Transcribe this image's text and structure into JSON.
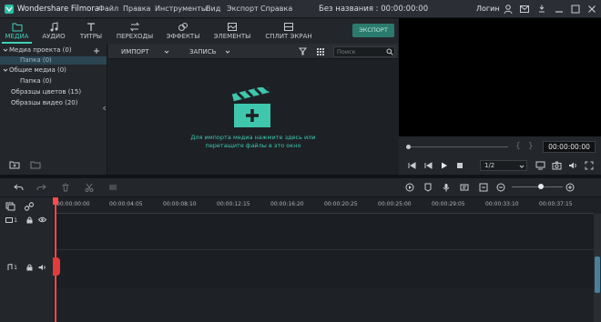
{
  "app": {
    "name": "Wondershare Filmora",
    "document_title": "Без названия : 00:00:00:00",
    "login": "Логин"
  },
  "menu": [
    "Файл",
    "Правка",
    "Инструменты",
    "Вид",
    "Экспорт",
    "Справка"
  ],
  "tabs": [
    {
      "label": "МЕДИА",
      "icon": "folder-icon",
      "active": true
    },
    {
      "label": "АУДИО",
      "icon": "music-note-icon",
      "active": false
    },
    {
      "label": "ТИТРЫ",
      "icon": "text-icon",
      "active": false
    },
    {
      "label": "ПЕРЕХОДЫ",
      "icon": "transition-icon",
      "active": false
    },
    {
      "label": "ЭФФЕКТЫ",
      "icon": "effects-icon",
      "active": false
    },
    {
      "label": "ЭЛЕМЕНТЫ",
      "icon": "elements-icon",
      "active": false
    },
    {
      "label": "СПЛИТ ЭКРАН",
      "icon": "split-screen-icon",
      "active": false
    }
  ],
  "export_label": "ЭКСПОРТ",
  "library": {
    "items": [
      {
        "label": "Медиа проекта (0)",
        "sub": false
      },
      {
        "label": "Папка (0)",
        "sub": true,
        "selected": true
      },
      {
        "label": "Общие медиа (0)",
        "sub": false
      },
      {
        "label": "Папка (0)",
        "sub": true
      },
      {
        "label": "Образцы цветов (15)",
        "sub": false
      },
      {
        "label": "Образцы видео (20)",
        "sub": false
      }
    ]
  },
  "media_toolbar": {
    "import_label": "ИМПОРТ",
    "record_label": "ЗАПИСЬ",
    "search_placeholder": "Поиск"
  },
  "media_hint": "Для импорта медиа нажмите здесь или перетащите файлы в это окно",
  "preview": {
    "timecode": "00:00:00:00",
    "ratio": "1/2"
  },
  "ruler": [
    "00:00:00:00",
    "00:00:04:05",
    "00:00:08:10",
    "00:00:12:15",
    "00:00:16:20",
    "00:00:20:25",
    "00:00:25:00",
    "00:00:29:05",
    "00:00:33:10",
    "00:00:37:15"
  ],
  "tracks": {
    "video_label": "1",
    "audio_label": "1"
  },
  "colors": {
    "accent": "#3fd0b6",
    "playhead": "#ff4b4b",
    "export_bg": "#2a7b6d"
  }
}
